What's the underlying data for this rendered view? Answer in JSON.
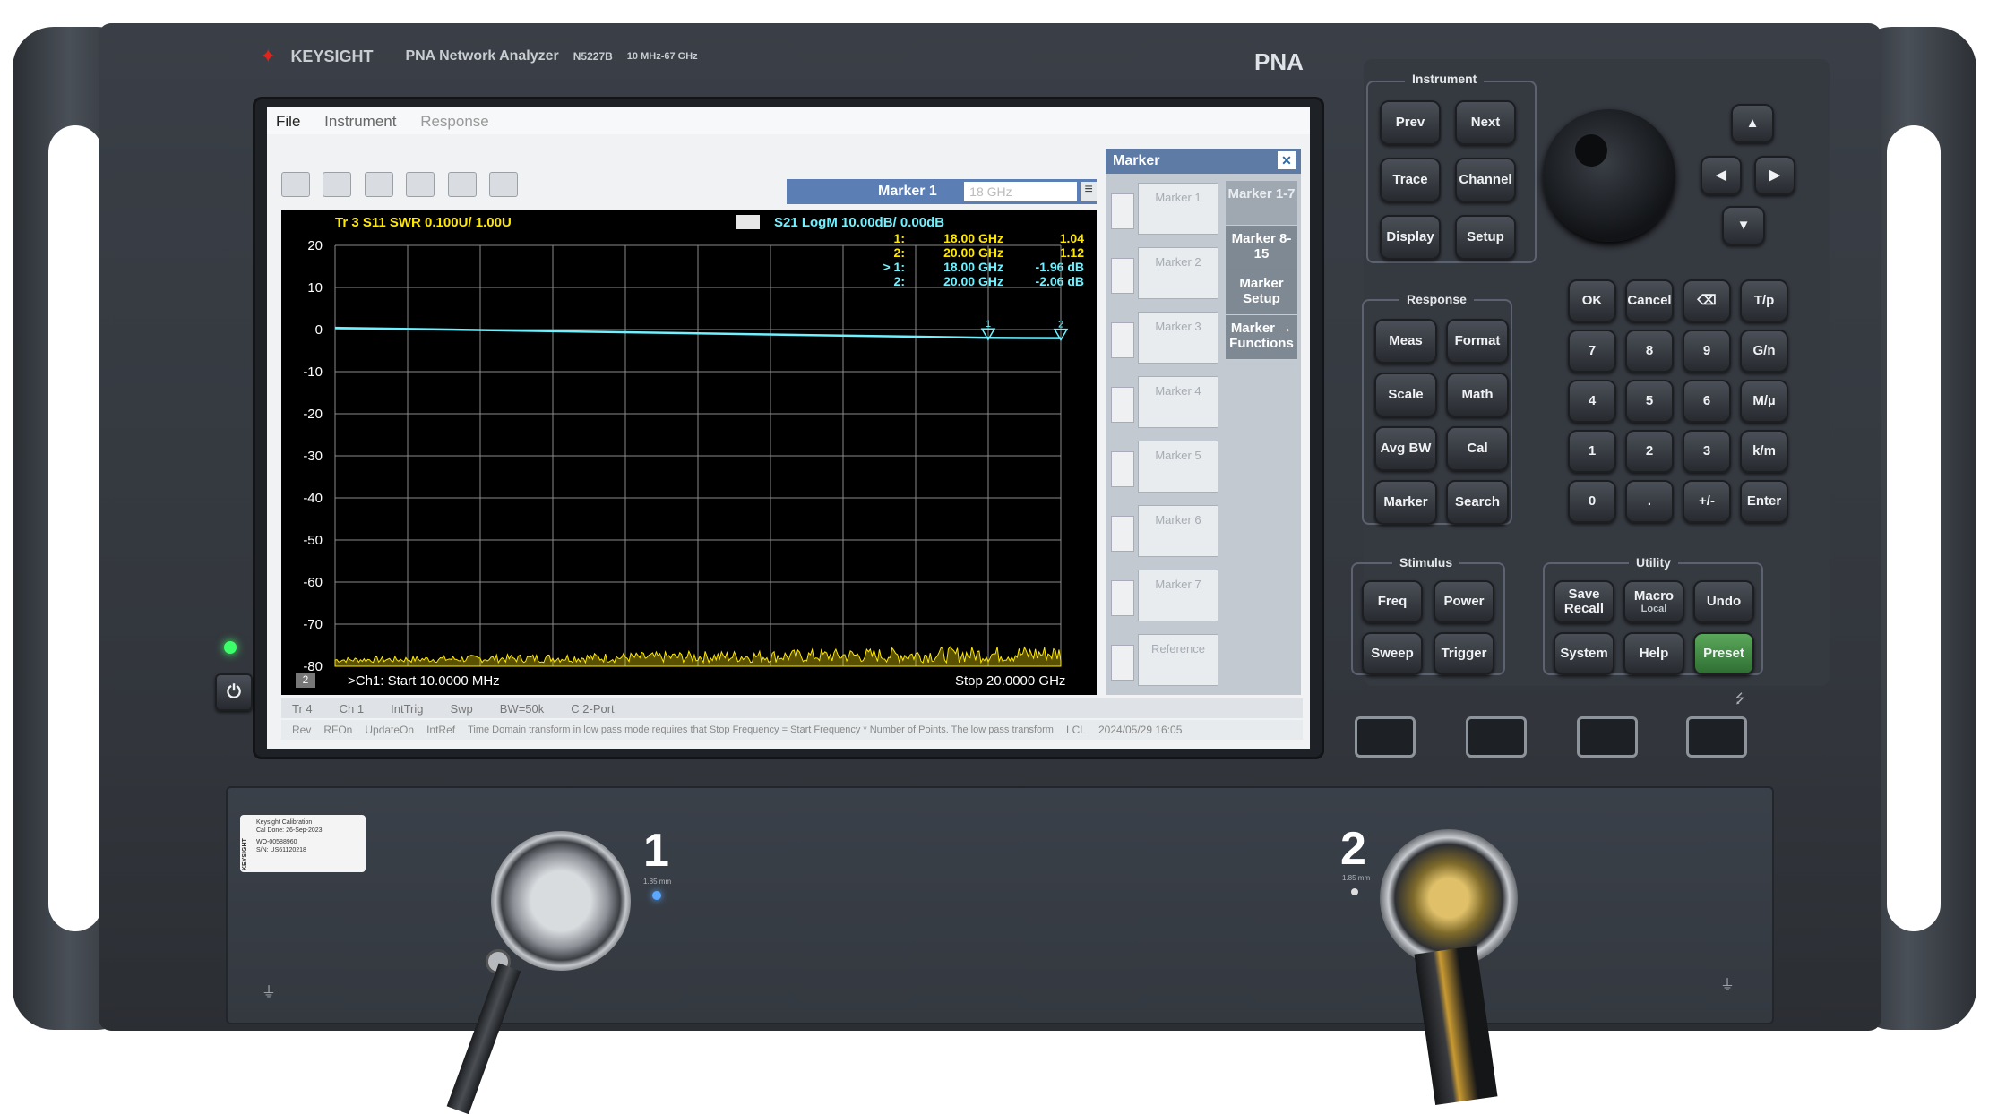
{
  "brand": {
    "logo": "KEYSIGHT",
    "product": "PNA Network Analyzer",
    "model": "N5227B",
    "range": "10 MHz-67 GHz",
    "badge": "PNA"
  },
  "app": {
    "menu": [
      "File",
      "Instrument",
      "Response"
    ],
    "marker_select_label": "Marker 1",
    "marker_select_value": "18 GHz"
  },
  "chart": {
    "trace1_label": "Tr 3  S11 SWR 0.100U/  1.00U",
    "trace2_label": "S21 LogM 10.00dB/  0.00dB",
    "y_ticks": [
      "20",
      "10",
      "0",
      "-10",
      "-20",
      "-30",
      "-40",
      "-50",
      "-60",
      "-70",
      "-80"
    ],
    "start_label": ">Ch1:  Start  10.0000 MHz",
    "stop_label": "Stop  20.0000 GHz",
    "window_badge": "2",
    "markers": [
      {
        "num": "1:",
        "freq": "18.00 GHz",
        "val": "1.04"
      },
      {
        "num": "2:",
        "freq": "20.00 GHz",
        "val": "1.12"
      },
      {
        "num": "> 1:",
        "freq": "18.00 GHz",
        "val": "-1.96 dB"
      },
      {
        "num": "2:",
        "freq": "20.00 GHz",
        "val": "-2.06 dB"
      }
    ]
  },
  "chart_data": {
    "type": "line",
    "title": "",
    "xlabel": "",
    "ylabel": "",
    "xlim": [
      0.01,
      20
    ],
    "ylim": [
      -80,
      20
    ],
    "x_unit": "GHz",
    "series": [
      {
        "name": "S21 LogM",
        "x": [
          0.01,
          18.0,
          20.0
        ],
        "values": [
          0.4,
          -1.96,
          -2.06
        ],
        "color": "#6ff1ff"
      },
      {
        "name": "S11 SWR",
        "x": [
          0.01,
          20.0
        ],
        "values": [
          -80,
          -80
        ],
        "color": "#ffe800"
      }
    ]
  },
  "status": {
    "row1": [
      "Tr 4",
      "Ch 1",
      "IntTrig",
      "Swp",
      "BW=50k",
      "C 2-Port"
    ],
    "row2": [
      "Rev",
      "RFOn",
      "UpdateOn",
      "IntRef",
      "Time Domain transform in low pass mode requires that  Stop Frequency = Start Frequency * Number of Points.  The low pass transform",
      "LCL",
      "2024/05/29 16:05"
    ]
  },
  "marker_panel": {
    "title": "Marker",
    "items": [
      "Marker 1",
      "Marker 2",
      "Marker 3",
      "Marker 4",
      "Marker 5",
      "Marker 6",
      "Marker 7",
      "Reference"
    ],
    "side_keys": [
      "Marker 1-7",
      "Marker 8-15",
      "Marker Setup",
      "Marker → Functions"
    ]
  },
  "groups": {
    "instrument": "Instrument",
    "response": "Response",
    "stimulus": "Stimulus",
    "utility": "Utility"
  },
  "keys": {
    "instrument": [
      "Prev",
      "Next",
      "Trace",
      "Channel",
      "Display",
      "Setup"
    ],
    "response": [
      "Meas",
      "Format",
      "Scale",
      "Math",
      "Avg BW",
      "Cal",
      "Marker",
      "Search"
    ],
    "stimulus": [
      "Freq",
      "Power",
      "Sweep",
      "Trigger"
    ],
    "utility": [
      "Save Recall",
      "Macro",
      "Undo",
      "System",
      "Help",
      "Preset"
    ],
    "macro_sub": "Local",
    "keypad": [
      "OK",
      "Cancel",
      "⌫",
      "T/p",
      "7",
      "8",
      "9",
      "G/n",
      "4",
      "5",
      "6",
      "M/µ",
      "1",
      "2",
      "3",
      "k/m",
      "0",
      ".",
      "+/-",
      "Enter"
    ]
  },
  "ports": {
    "port1": "1",
    "port2": "2",
    "port1_sub": "1.85 mm",
    "port2_sub": "1.85 mm"
  },
  "cal_label": {
    "line1": "Keysight Calibration",
    "line2": "Cal Done: 26-Sep-2023",
    "line3": "WO-00588960",
    "line4": "S/N: US61120218",
    "vertical": "KEYSIGHT"
  }
}
